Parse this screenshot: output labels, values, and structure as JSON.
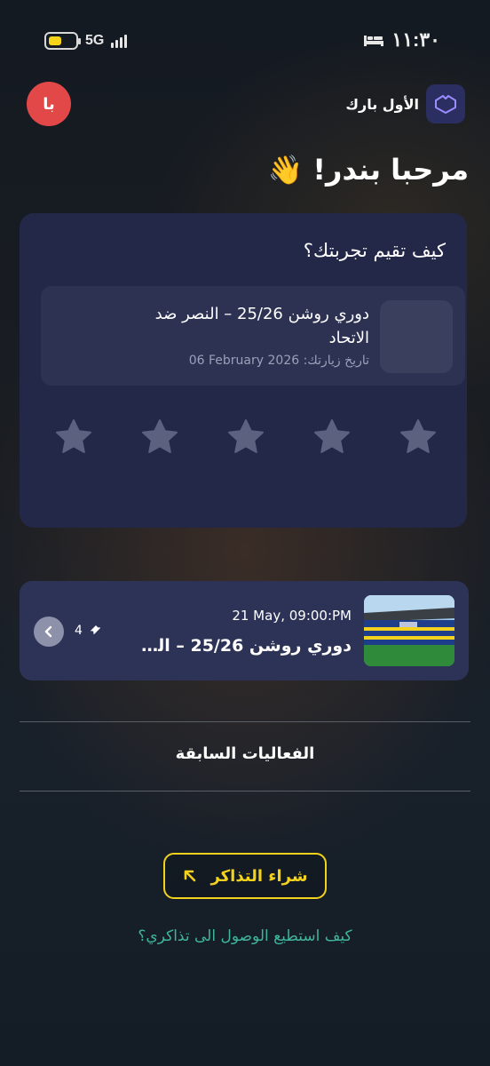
{
  "status_bar": {
    "network": "5G",
    "time": "١١:٣٠"
  },
  "header": {
    "avatar_initials": "با",
    "brand_name": "الأول بارك",
    "greeting": "مرحبا بندر! 👋"
  },
  "rating": {
    "question": "كيف تقيم تجربتك؟",
    "visit_title": "دوري روشن 25/26 – النصر ضد الاتحاد",
    "visit_date_label": "تاريخ زيارتك:",
    "visit_date": "06 February 2026",
    "stars_total": 5,
    "stars_selected": 0
  },
  "event": {
    "datetime": "21 May, 09:00:PM",
    "title": "دوري روشن 25/26 – الذ...",
    "ticket_count": "4"
  },
  "past_events_label": "الفعاليات السابقة",
  "buy_button_label": "شراء التذاكر",
  "help_link": "كيف استطيع الوصول الى تذاكري؟",
  "colors": {
    "accent_yellow": "#f3d21b",
    "link_teal": "#3fb59c",
    "avatar_red": "#e24848",
    "card_bg": "#232848"
  }
}
